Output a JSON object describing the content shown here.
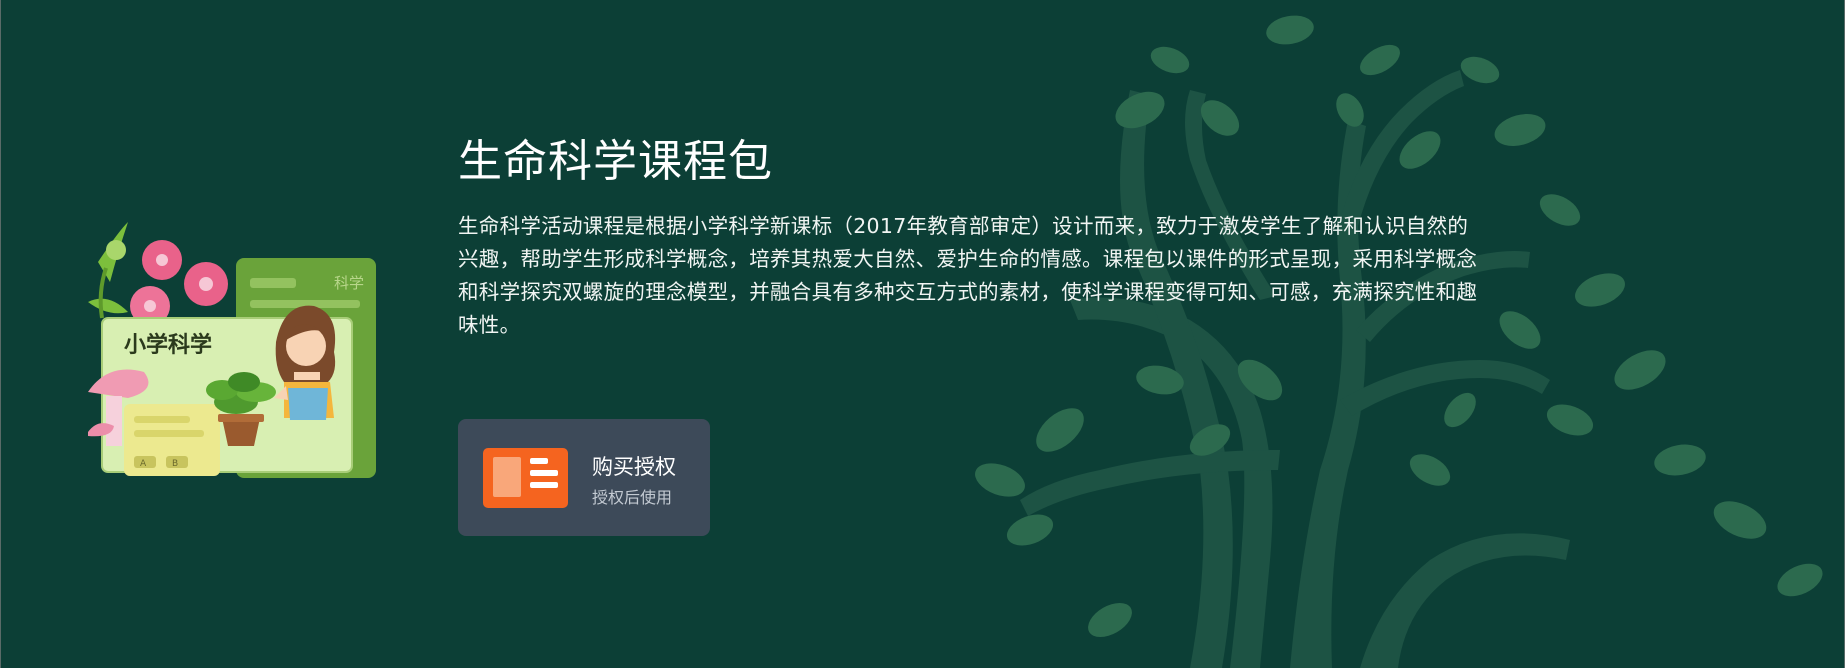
{
  "course": {
    "title": "生命科学课程包",
    "description": "生命科学活动课程是根据小学科学新课标（2017年教育部审定）设计而来，致力于激发学生了解和认识自然的兴趣，帮助学生形成科学概念，培养其热爱大自然、爱护生命的情感。课程包以课件的形式呈现，采用科学概念和科学探究双螺旋的理念模型，并融合具有多种交互方式的素材，使科学课程变得可知、可感，充满探究性和趣味性。"
  },
  "illustration": {
    "front_card_title": "小学科学",
    "back_card_label": "科学",
    "quiz_option_a": "A",
    "quiz_option_b": "B"
  },
  "purchase": {
    "title": "购买授权",
    "subtitle": "授权后使用"
  },
  "colors": {
    "background": "#0c3f36",
    "tree": "#1e5545",
    "button_bg": "#3d4a59",
    "icon_orange": "#f5641f"
  },
  "icons": {
    "purchase": "document-license-icon",
    "background": "tree-illustration"
  }
}
